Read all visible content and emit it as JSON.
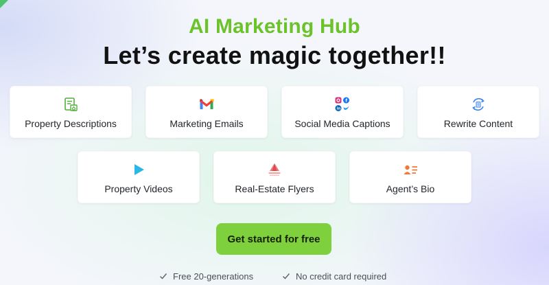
{
  "hero": {
    "title": "AI Marketing Hub",
    "subtitle": "Let’s create magic together!!"
  },
  "features": [
    {
      "label": "Property Descriptions",
      "icon": "document-home-icon"
    },
    {
      "label": "Marketing Emails",
      "icon": "gmail-icon"
    },
    {
      "label": "Social Media Captions",
      "icon": "social-media-icons"
    },
    {
      "label": "Rewrite Content",
      "icon": "rewrite-cycle-icon"
    },
    {
      "label": "Property Videos",
      "icon": "play-icon"
    },
    {
      "label": "Real-Estate Flyers",
      "icon": "flyer-icon"
    },
    {
      "label": "Agent’s Bio",
      "icon": "id-card-icon"
    }
  ],
  "cta": {
    "label": "Get started for free"
  },
  "perks": [
    {
      "label": "Free 20-generations"
    },
    {
      "label": "No credit card required"
    }
  ],
  "colors": {
    "accent": "#6cc22b",
    "cta": "#7ed13c",
    "headline": "#121212"
  }
}
